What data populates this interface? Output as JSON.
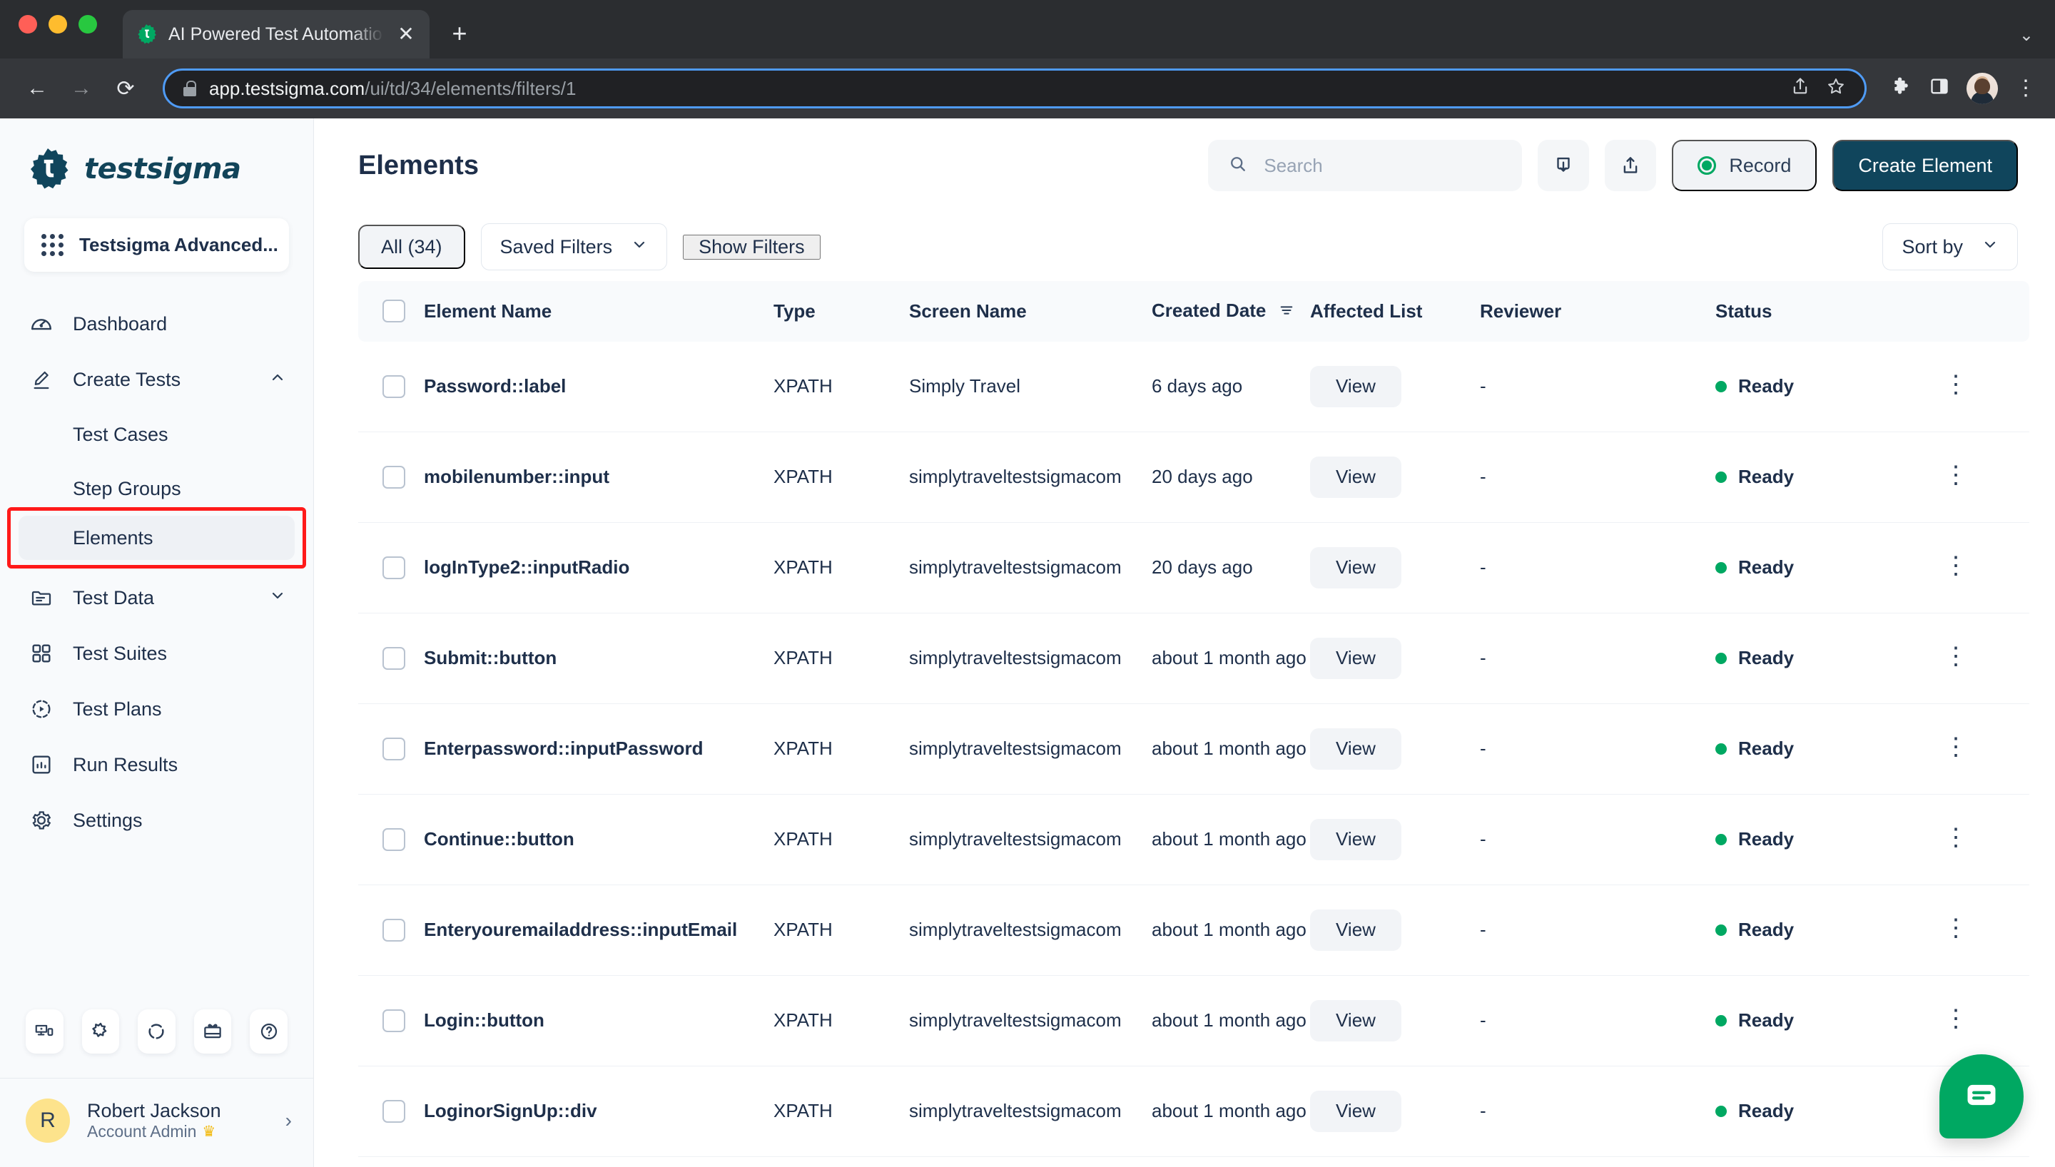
{
  "browser": {
    "tab_title": "AI Powered Test Automation P",
    "favicon": "testsigma-gear-icon",
    "new_tab_label": "+",
    "close_label": "✕",
    "tab_list_chevron": "⌄",
    "back_label": "←",
    "forward_label": "→",
    "reload_label": "⟳",
    "url_domain": "app.testsigma.com",
    "url_path": "/ui/td/34/elements/filters/1",
    "share_icon": "share-icon",
    "bookmark_icon": "star-icon",
    "extensions_icon": "puzzle-icon",
    "sidepanel_icon": "side-panel-icon",
    "menu_icon": "three-dot-menu-icon"
  },
  "sidebar": {
    "brand": "testsigma",
    "workspace": "Testsigma Advanced...",
    "nav": [
      {
        "label": "Dashboard",
        "icon": "speedometer-icon",
        "type": "item",
        "expandable": false
      },
      {
        "label": "Create Tests",
        "icon": "pencil-icon",
        "type": "item",
        "expandable": true,
        "expanded": true
      },
      {
        "label": "Test Cases",
        "icon": "",
        "type": "sub",
        "active": false
      },
      {
        "label": "Step Groups",
        "icon": "",
        "type": "sub",
        "active": false
      },
      {
        "label": "Elements",
        "icon": "",
        "type": "sub",
        "active": true
      },
      {
        "label": "Test Data",
        "icon": "folder-icon",
        "type": "item",
        "expandable": true,
        "expanded": false
      },
      {
        "label": "Test Suites",
        "icon": "grid-squares-icon",
        "type": "item",
        "expandable": false
      },
      {
        "label": "Test Plans",
        "icon": "play-circle-icon",
        "type": "item",
        "expandable": false
      },
      {
        "label": "Run Results",
        "icon": "bar-chart-icon",
        "type": "item",
        "expandable": false
      },
      {
        "label": "Settings",
        "icon": "gear-icon",
        "type": "item",
        "expandable": false
      }
    ],
    "quick_icons": [
      "device-star-icon",
      "puzzle-icon",
      "progress-circle-icon",
      "gift-icon",
      "help-circle-icon"
    ],
    "profile": {
      "initial": "R",
      "name": "Robert Jackson",
      "role": "Account Admin",
      "crown": "♛",
      "chevron": "›"
    }
  },
  "header": {
    "title": "Elements",
    "search_placeholder": "Search",
    "search_value": "",
    "search_icon": "search-icon",
    "import_icon": "import-download-icon",
    "export_icon": "export-upload-icon",
    "record_label": "Record",
    "create_label": "Create Element"
  },
  "filterbar": {
    "all_label": "All (34)",
    "saved_filters_label": "Saved Filters",
    "show_filters_label": "Show Filters",
    "sort_by_label": "Sort by"
  },
  "table": {
    "columns": [
      "Element Name",
      "Type",
      "Screen Name",
      "Created Date",
      "Affected List",
      "Reviewer",
      "Status"
    ],
    "sorted_column": "Created Date",
    "sort_icon": "sort-filter-icon",
    "rows": [
      {
        "name": "Password::label",
        "type": "XPATH",
        "screen": "Simply Travel",
        "created": "6 days ago",
        "affected": "View",
        "reviewer": "-",
        "status": "Ready",
        "status_color": "#00a862"
      },
      {
        "name": "mobilenumber::input",
        "type": "XPATH",
        "screen": "simplytraveltestsigmacom",
        "created": "20 days ago",
        "affected": "View",
        "reviewer": "-",
        "status": "Ready",
        "status_color": "#00a862"
      },
      {
        "name": "logInType2::inputRadio",
        "type": "XPATH",
        "screen": "simplytraveltestsigmacom",
        "created": "20 days ago",
        "affected": "View",
        "reviewer": "-",
        "status": "Ready",
        "status_color": "#00a862"
      },
      {
        "name": "Submit::button",
        "type": "XPATH",
        "screen": "simplytraveltestsigmacom",
        "created": "about 1 month ago",
        "affected": "View",
        "reviewer": "-",
        "status": "Ready",
        "status_color": "#00a862"
      },
      {
        "name": "Enterpassword::inputPassword",
        "type": "XPATH",
        "screen": "simplytraveltestsigmacom",
        "created": "about 1 month ago",
        "affected": "View",
        "reviewer": "-",
        "status": "Ready",
        "status_color": "#00a862"
      },
      {
        "name": "Continue::button",
        "type": "XPATH",
        "screen": "simplytraveltestsigmacom",
        "created": "about 1 month ago",
        "affected": "View",
        "reviewer": "-",
        "status": "Ready",
        "status_color": "#00a862"
      },
      {
        "name": "Enteryouremailaddress::inputEmail",
        "type": "XPATH",
        "screen": "simplytraveltestsigmacom",
        "created": "about 1 month ago",
        "affected": "View",
        "reviewer": "-",
        "status": "Ready",
        "status_color": "#00a862"
      },
      {
        "name": "Login::button",
        "type": "XPATH",
        "screen": "simplytraveltestsigmacom",
        "created": "about 1 month ago",
        "affected": "View",
        "reviewer": "-",
        "status": "Ready",
        "status_color": "#00a862"
      },
      {
        "name": "LoginorSignUp::div",
        "type": "XPATH",
        "screen": "simplytraveltestsigmacom",
        "created": "about 1 month ago",
        "affected": "View",
        "reviewer": "-",
        "status": "Ready",
        "status_color": "#00a862"
      }
    ]
  },
  "chat": {
    "icon": "chat-bubble-icon"
  },
  "colors": {
    "brand_dark": "#10455c",
    "accent_green": "#00a862",
    "text_primary": "#1e2f4a",
    "highlight_red": "#ff1a1a",
    "sidebar_bg": "#f8fafc"
  }
}
